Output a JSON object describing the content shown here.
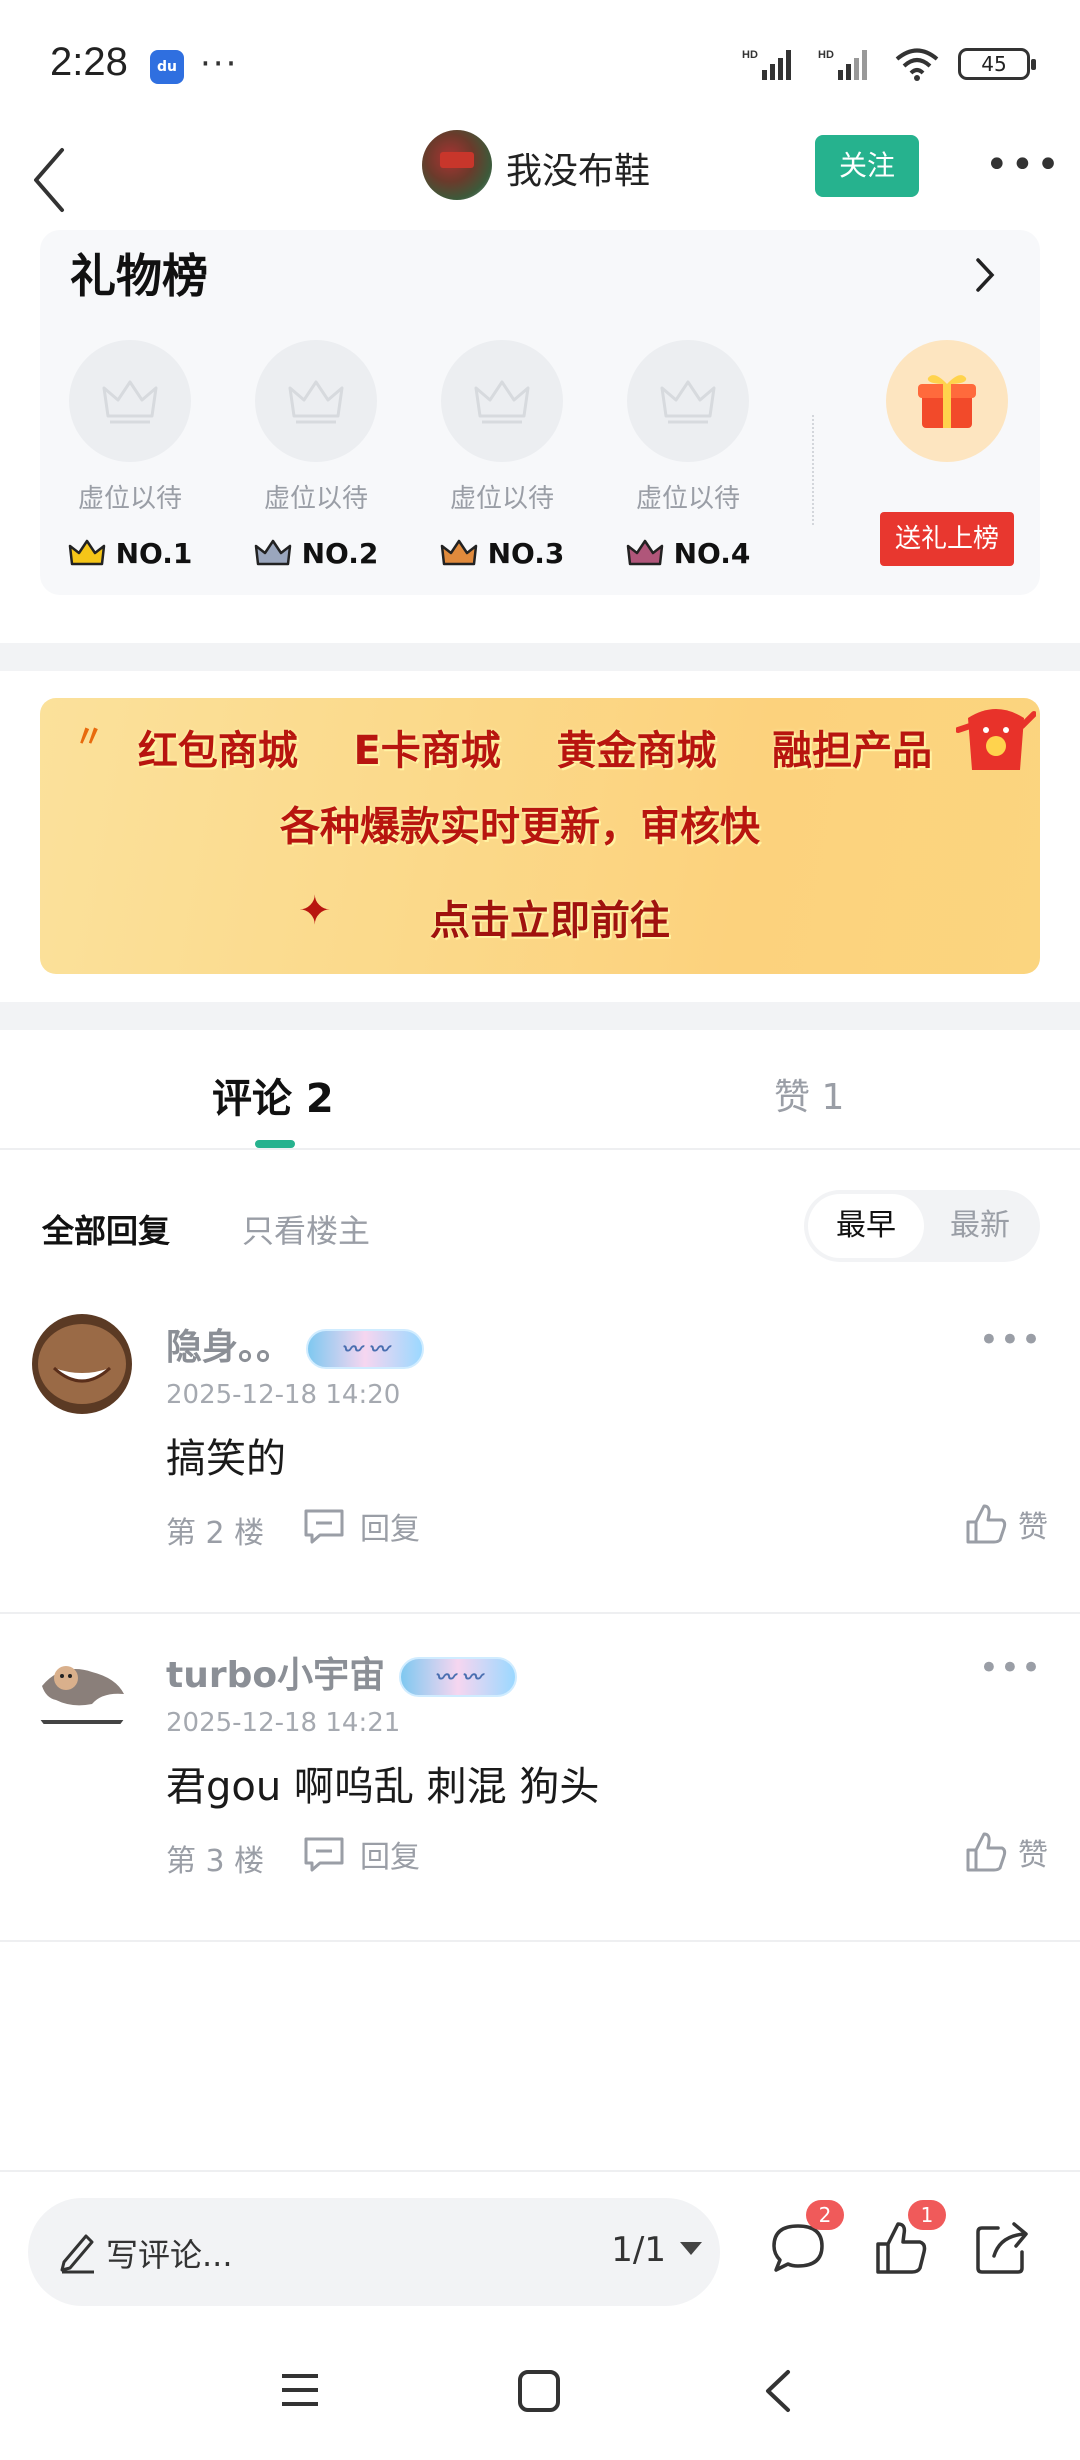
{
  "status_bar": {
    "time": "2:28",
    "battery": "45"
  },
  "header": {
    "author_name": "我没布鞋",
    "follow_label": "关注"
  },
  "gift_board": {
    "title": "礼物榜",
    "slots": [
      {
        "placeholder": "虚位以待",
        "rank": "NO.1",
        "crown_color": "#f5c518"
      },
      {
        "placeholder": "虚位以待",
        "rank": "NO.2",
        "crown_color": "#9aa6bd"
      },
      {
        "placeholder": "虚位以待",
        "rank": "NO.3",
        "crown_color": "#e08a3c"
      },
      {
        "placeholder": "虚位以待",
        "rank": "NO.4",
        "crown_color": "#b0567a"
      }
    ],
    "send_label": "送礼上榜"
  },
  "banner": {
    "items": [
      "红包商城",
      "E卡商城",
      "黄金商城",
      "融担产品"
    ],
    "line2": "各种爆款实时更新，审核快",
    "line3": "点击立即前往"
  },
  "tabs": {
    "comments": "评论 2",
    "likes": "赞 1"
  },
  "filter": {
    "all": "全部回复",
    "op_only": "只看楼主",
    "sort_earliest": "最早",
    "sort_latest": "最新"
  },
  "comments": [
    {
      "name": "隐身。。",
      "time": "2025-12-18 14:20",
      "text": "搞笑的",
      "floor": "第 2 楼",
      "reply_label": "回复",
      "like_label": "赞"
    },
    {
      "name": "turbo小宇宙",
      "time": "2025-12-18 14:21",
      "text": "君gou 啊呜乱 刺混 狗头",
      "floor": "第 3 楼",
      "reply_label": "回复",
      "like_label": "赞"
    }
  ],
  "bottom_bar": {
    "write_placeholder": "写评论...",
    "pager": "1/1",
    "comment_count": "2",
    "like_count": "1"
  },
  "colors": {
    "accent": "#26b28e",
    "gift_red": "#e8372f",
    "badge_red": "#f05a5a"
  }
}
